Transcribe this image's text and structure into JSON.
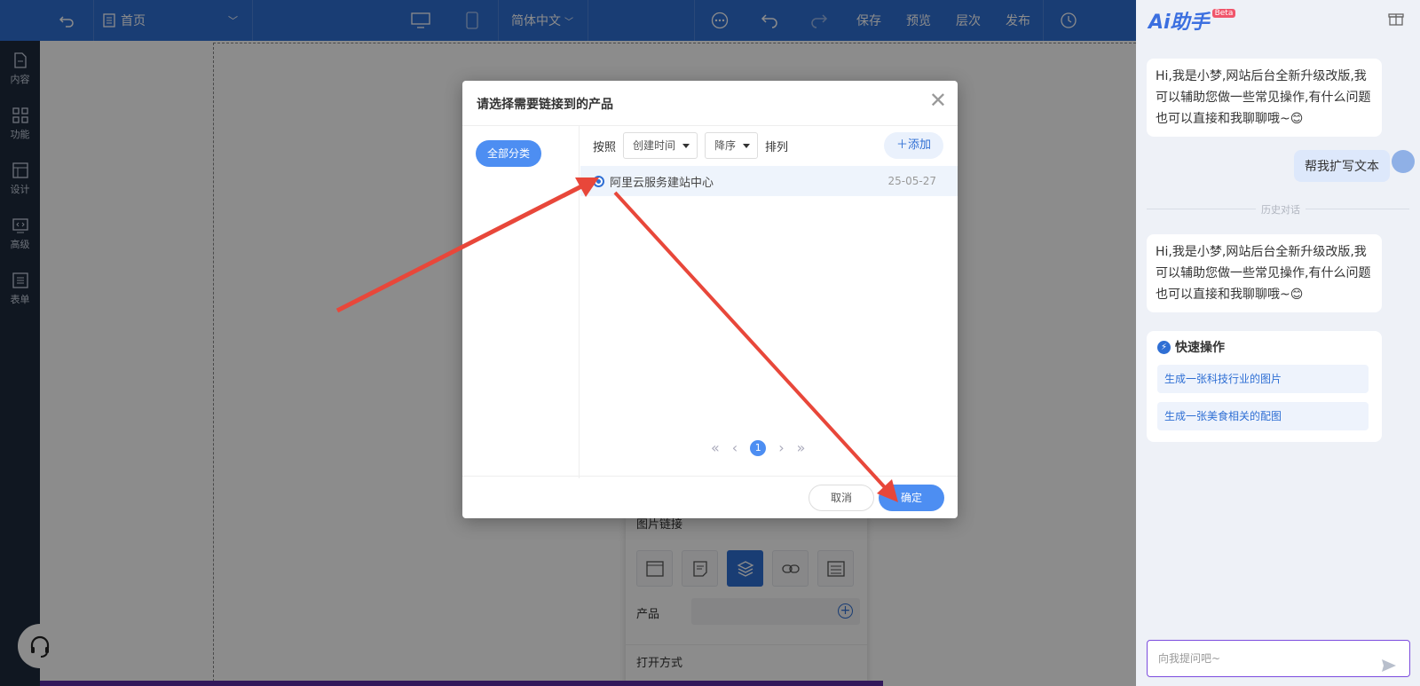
{
  "topbar": {
    "page_select": "首页",
    "language": "简体中文",
    "save": "保存",
    "preview": "预览",
    "layers": "层次",
    "publish": "发布"
  },
  "sidebar": {
    "items": [
      {
        "label": "内容",
        "icon": "file-icon"
      },
      {
        "label": "功能",
        "icon": "grid-icon"
      },
      {
        "label": "设计",
        "icon": "layout-icon"
      },
      {
        "label": "高级",
        "icon": "code-icon"
      },
      {
        "label": "表单",
        "icon": "list-icon"
      }
    ]
  },
  "property_panel": {
    "title": "图片链接",
    "product_label": "产品",
    "open_mode_label": "打开方式"
  },
  "modal": {
    "title": "请选择需要链接到的产品",
    "category_all": "全部分类",
    "sort_by_label": "按照",
    "sort_field": "创建时间",
    "sort_order": "降序",
    "sort_suffix": "排列",
    "add_label": "添加",
    "rows": [
      {
        "name": "阿里云服务建站中心",
        "date": "25-05-27"
      }
    ],
    "current_page": "1",
    "cancel": "取消",
    "confirm": "确定"
  },
  "ai": {
    "logo": "Ai助手",
    "beta": "Beta",
    "greeting_1": "Hi,我是小梦,网站后台全新升级改版,我可以辅助您做一些常见操作,有什么问题也可以直接和我聊聊哦~😊",
    "user_msg": "帮我扩写文本",
    "history_label": "历史对话",
    "greeting_2": "Hi,我是小梦,网站后台全新升级改版,我可以辅助您做一些常见操作,有什么问题也可以直接和我聊聊哦~😊",
    "quick_title": "快速操作",
    "quick_1": "生成一张科技行业的图片",
    "quick_2": "生成一张美食相关的配图",
    "input_placeholder": "向我提问吧~"
  },
  "colors": {
    "primary": "#2f6fd4",
    "accent": "#4d8ef2",
    "arrow": "#e8473a"
  }
}
